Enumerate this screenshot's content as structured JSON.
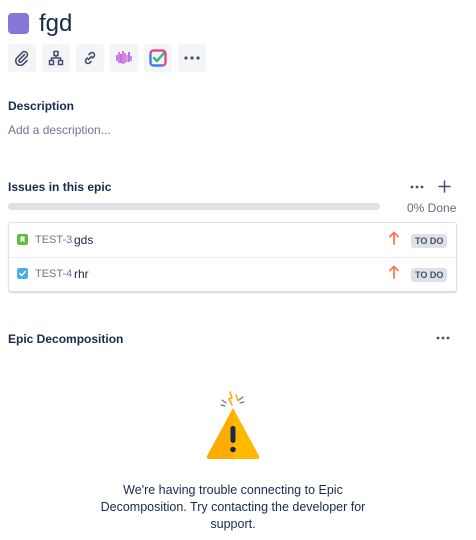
{
  "issue": {
    "title": "fgd",
    "color": "#8777d9"
  },
  "toolbar": {
    "buttons": [
      {
        "name": "attach-icon"
      },
      {
        "name": "child-issue-icon"
      },
      {
        "name": "link-issue-icon"
      },
      {
        "name": "app-pixel-icon"
      },
      {
        "name": "checklist-app-icon"
      },
      {
        "name": "more-icon"
      }
    ]
  },
  "description": {
    "label": "Description",
    "placeholder": "Add a description..."
  },
  "epic": {
    "label": "Issues in this epic",
    "progress_percent": 0,
    "progress_label": "0% Done",
    "issues": [
      {
        "key": "TEST-3",
        "summary": "gds",
        "type": "story",
        "type_color": "#63ba3c",
        "priority": "high",
        "status": "TO DO"
      },
      {
        "key": "TEST-4",
        "summary": "rhr",
        "type": "task",
        "type_color": "#4bade8",
        "priority": "high",
        "status": "TO DO"
      }
    ]
  },
  "decomposition": {
    "label": "Epic Decomposition",
    "error_message": "We're having trouble connecting to Epic Decomposition. Try contacting the developer for support."
  },
  "colors": {
    "priority_high": "#ff7452",
    "warning": "#ffab00",
    "progress_track": "#dfe1e6"
  }
}
